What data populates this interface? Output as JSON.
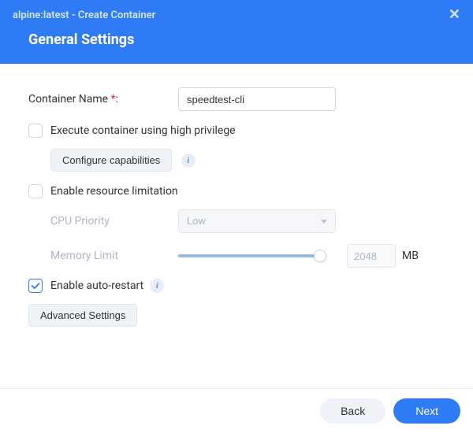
{
  "header": {
    "titlebar": "alpine:latest - Create Container",
    "section_title": "General Settings"
  },
  "form": {
    "container_name_label": "Container Name",
    "container_name_value": "speedtest-cli",
    "execute_high_priv_label": "Execute container using high privilege",
    "execute_high_priv_checked": false,
    "configure_caps_label": "Configure capabilities",
    "enable_resource_limit_label": "Enable resource limitation",
    "enable_resource_limit_checked": false,
    "cpu_priority_label": "CPU Priority",
    "cpu_priority_value": "Low",
    "memory_limit_label": "Memory Limit",
    "memory_limit_value": "2048",
    "memory_limit_unit": "MB",
    "enable_auto_restart_label": "Enable auto-restart",
    "enable_auto_restart_checked": true,
    "advanced_settings_label": "Advanced Settings"
  },
  "footer": {
    "back_label": "Back",
    "next_label": "Next"
  }
}
